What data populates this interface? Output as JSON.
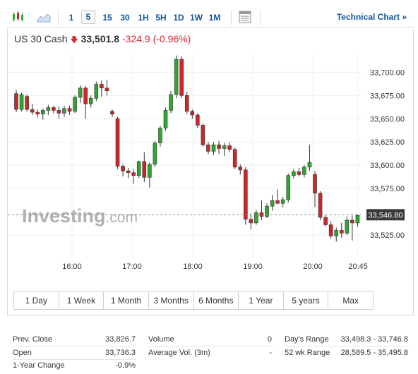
{
  "toolbar": {
    "intervals": [
      "1",
      "5",
      "15",
      "30",
      "1H",
      "5H",
      "1D",
      "1W",
      "1M"
    ],
    "active_interval": "5",
    "technical_chart_label": "Technical Chart »"
  },
  "instrument": {
    "name": "US 30 Cash",
    "price": "33,501.8",
    "change": "-324.9",
    "change_pct": "(-0.96%)"
  },
  "chart": {
    "watermark_main": "Investing",
    "watermark_suffix": ".com",
    "current_price_label": "33,546.80",
    "y_ticks": [
      "33,700.00",
      "33,675.00",
      "33,650.00",
      "33,625.00",
      "33,600.00",
      "33,575.00",
      "33,525.00"
    ],
    "x_ticks": [
      "16:00",
      "17:00",
      "18:00",
      "19:00",
      "20:00",
      "20:45"
    ]
  },
  "chart_data": {
    "type": "candlestick",
    "ylim": [
      33500,
      33720
    ],
    "current_price": 33546.8,
    "y_ticks": [
      33525,
      33575,
      33600,
      33625,
      33650,
      33675,
      33700
    ],
    "x_tick_labels": [
      "16:00",
      "17:00",
      "18:00",
      "19:00",
      "20:00",
      "20:45"
    ],
    "candles": [
      {
        "o": 33677,
        "h": 33681,
        "l": 33657,
        "c": 33660
      },
      {
        "o": 33660,
        "h": 33678,
        "l": 33658,
        "c": 33676
      },
      {
        "o": 33674,
        "h": 33676,
        "l": 33658,
        "c": 33660
      },
      {
        "o": 33660,
        "h": 33666,
        "l": 33654,
        "c": 33657
      },
      {
        "o": 33657,
        "h": 33660,
        "l": 33651,
        "c": 33655
      },
      {
        "o": 33655,
        "h": 33661,
        "l": 33649,
        "c": 33659
      },
      {
        "o": 33659,
        "h": 33665,
        "l": 33654,
        "c": 33662
      },
      {
        "o": 33662,
        "h": 33664,
        "l": 33656,
        "c": 33659
      },
      {
        "o": 33659,
        "h": 33663,
        "l": 33650,
        "c": 33656
      },
      {
        "o": 33656,
        "h": 33664,
        "l": 33652,
        "c": 33661
      },
      {
        "o": 33661,
        "h": 33664,
        "l": 33654,
        "c": 33658
      },
      {
        "o": 33658,
        "h": 33675,
        "l": 33656,
        "c": 33673
      },
      {
        "o": 33673,
        "h": 33686,
        "l": 33667,
        "c": 33683
      },
      {
        "o": 33683,
        "h": 33685,
        "l": 33650,
        "c": 33666
      },
      {
        "o": 33666,
        "h": 33675,
        "l": 33662,
        "c": 33672
      },
      {
        "o": 33672,
        "h": 33690,
        "l": 33669,
        "c": 33687
      },
      {
        "o": 33687,
        "h": 33691,
        "l": 33674,
        "c": 33683
      },
      {
        "o": 33683,
        "h": 33692,
        "l": 33675,
        "c": 33680
      },
      {
        "o": 33658,
        "h": 33660,
        "l": 33652,
        "c": 33655
      },
      {
        "o": 33650,
        "h": 33652,
        "l": 33596,
        "c": 33599
      },
      {
        "o": 33599,
        "h": 33601,
        "l": 33588,
        "c": 33594
      },
      {
        "o": 33594,
        "h": 33597,
        "l": 33586,
        "c": 33592
      },
      {
        "o": 33592,
        "h": 33596,
        "l": 33580,
        "c": 33589
      },
      {
        "o": 33589,
        "h": 33605,
        "l": 33586,
        "c": 33604
      },
      {
        "o": 33604,
        "h": 33614,
        "l": 33582,
        "c": 33587
      },
      {
        "o": 33587,
        "h": 33603,
        "l": 33576,
        "c": 33601
      },
      {
        "o": 33601,
        "h": 33626,
        "l": 33598,
        "c": 33624
      },
      {
        "o": 33624,
        "h": 33642,
        "l": 33620,
        "c": 33640
      },
      {
        "o": 33640,
        "h": 33662,
        "l": 33637,
        "c": 33659
      },
      {
        "o": 33659,
        "h": 33680,
        "l": 33656,
        "c": 33676
      },
      {
        "o": 33676,
        "h": 33718,
        "l": 33672,
        "c": 33714
      },
      {
        "o": 33714,
        "h": 33717,
        "l": 33672,
        "c": 33675
      },
      {
        "o": 33675,
        "h": 33679,
        "l": 33655,
        "c": 33658
      },
      {
        "o": 33658,
        "h": 33660,
        "l": 33650,
        "c": 33654
      },
      {
        "o": 33654,
        "h": 33656,
        "l": 33640,
        "c": 33643
      },
      {
        "o": 33643,
        "h": 33645,
        "l": 33620,
        "c": 33622
      },
      {
        "o": 33622,
        "h": 33625,
        "l": 33612,
        "c": 33615
      },
      {
        "o": 33615,
        "h": 33625,
        "l": 33611,
        "c": 33622
      },
      {
        "o": 33622,
        "h": 33626,
        "l": 33612,
        "c": 33618
      },
      {
        "o": 33618,
        "h": 33624,
        "l": 33610,
        "c": 33621
      },
      {
        "o": 33621,
        "h": 33625,
        "l": 33614,
        "c": 33617
      },
      {
        "o": 33617,
        "h": 33619,
        "l": 33596,
        "c": 33598
      },
      {
        "o": 33598,
        "h": 33601,
        "l": 33590,
        "c": 33595
      },
      {
        "o": 33595,
        "h": 33598,
        "l": 33536,
        "c": 33542
      },
      {
        "o": 33542,
        "h": 33548,
        "l": 33531,
        "c": 33538
      },
      {
        "o": 33538,
        "h": 33552,
        "l": 33536,
        "c": 33549
      },
      {
        "o": 33549,
        "h": 33562,
        "l": 33541,
        "c": 33545
      },
      {
        "o": 33545,
        "h": 33559,
        "l": 33543,
        "c": 33556
      },
      {
        "o": 33556,
        "h": 33568,
        "l": 33551,
        "c": 33562
      },
      {
        "o": 33562,
        "h": 33574,
        "l": 33558,
        "c": 33559
      },
      {
        "o": 33559,
        "h": 33566,
        "l": 33555,
        "c": 33563
      },
      {
        "o": 33563,
        "h": 33591,
        "l": 33560,
        "c": 33589
      },
      {
        "o": 33589,
        "h": 33596,
        "l": 33586,
        "c": 33593
      },
      {
        "o": 33593,
        "h": 33597,
        "l": 33588,
        "c": 33590
      },
      {
        "o": 33590,
        "h": 33600,
        "l": 33587,
        "c": 33598
      },
      {
        "o": 33598,
        "h": 33622,
        "l": 33594,
        "c": 33603
      },
      {
        "o": 33590,
        "h": 33594,
        "l": 33555,
        "c": 33570
      },
      {
        "o": 33570,
        "h": 33572,
        "l": 33541,
        "c": 33544
      },
      {
        "o": 33544,
        "h": 33547,
        "l": 33534,
        "c": 33536
      },
      {
        "o": 33536,
        "h": 33540,
        "l": 33521,
        "c": 33524
      },
      {
        "o": 33524,
        "h": 33533,
        "l": 33518,
        "c": 33530
      },
      {
        "o": 33530,
        "h": 33538,
        "l": 33522,
        "c": 33527
      },
      {
        "o": 33527,
        "h": 33545,
        "l": 33525,
        "c": 33541
      },
      {
        "o": 33541,
        "h": 33546,
        "l": 33519,
        "c": 33538
      },
      {
        "o": 33538,
        "h": 33547,
        "l": 33534,
        "c": 33546
      }
    ]
  },
  "ranges": [
    "1 Day",
    "1 Week",
    "1 Month",
    "3 Months",
    "6 Months",
    "1 Year",
    "5 years",
    "Max"
  ],
  "stats": {
    "prev_close_label": "Prev. Close",
    "prev_close": "33,826.7",
    "open_label": "Open",
    "open": "33,736.3",
    "year_change_label": "1-Year Change",
    "year_change": "-0.9%",
    "volume_label": "Volume",
    "volume": "0",
    "avg_volume_label": "Average Vol. (3m)",
    "avg_volume": "-",
    "days_range_label": "Day's Range",
    "days_range": "33,498.3 - 33,746.8",
    "wk52_range_label": "52 wk Range",
    "wk52_range": "28,589.5 - 35,495.8"
  },
  "colors": {
    "up": "#2ea82e",
    "down": "#c8282a",
    "link": "#1256a0",
    "negative": "#e0242d"
  }
}
